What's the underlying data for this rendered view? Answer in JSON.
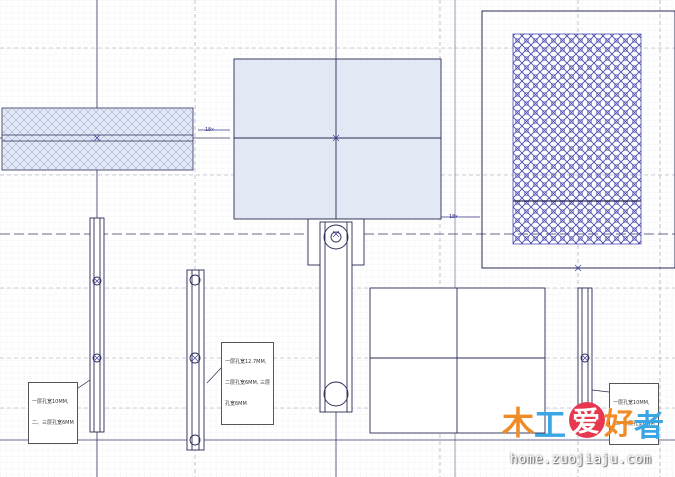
{
  "canvas": {
    "background": "#ffffff",
    "grid_color": "#c9cbd6",
    "axis_color": "#3a3a6a",
    "part_stroke": "#2b2b55",
    "panel_fill": "#e3e9f4",
    "lattice_color": "#4a4ab0"
  },
  "notes": [
    {
      "lines": [
        "一层孔宽10MM,",
        "二、三层孔宽6MM"
      ]
    },
    {
      "lines": [
        "一层孔宽12.7MM,",
        "二层孔宽6MM, 三层",
        "孔宽6MM"
      ]
    },
    {
      "lines": [
        "一层孔宽10MM,",
        "二、三层孔宽6MM"
      ]
    }
  ],
  "dimensions": {
    "label_1": "18×",
    "label_2": "18×"
  },
  "watermark": {
    "logo_chars": [
      "木",
      "工",
      "爱",
      "好",
      "者"
    ],
    "logo_colors": [
      "#f08c28",
      "#3aa6e6",
      "#e8384f",
      "#f08c28",
      "#3aa6e6"
    ],
    "url": "home.zuojiaju.com"
  }
}
